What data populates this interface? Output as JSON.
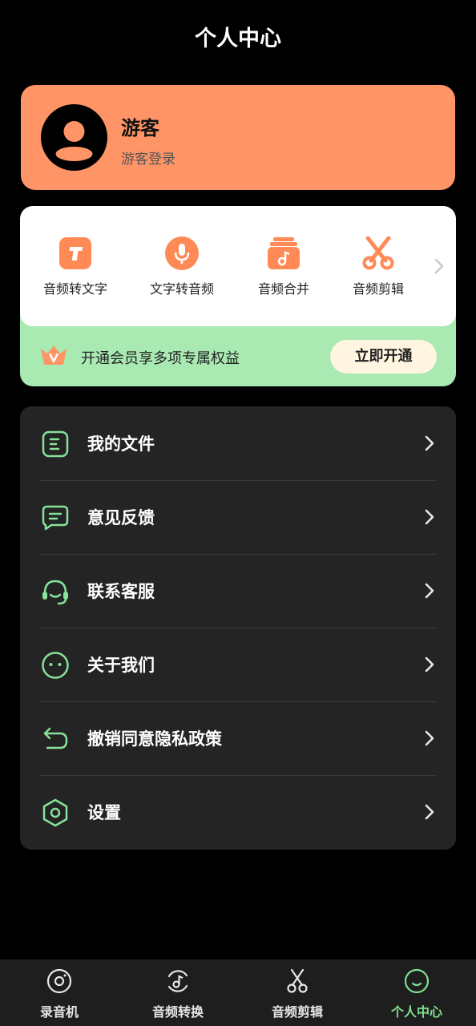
{
  "header": {
    "title": "个人中心"
  },
  "user": {
    "name": "游客",
    "login_label": "游客登录"
  },
  "tools": [
    {
      "label": "音频转文字",
      "icon": "text-t-icon"
    },
    {
      "label": "文字转音频",
      "icon": "microphone-icon"
    },
    {
      "label": "音频合并",
      "icon": "music-merge-icon"
    },
    {
      "label": "音频剪辑",
      "icon": "scissors-icon"
    }
  ],
  "vip": {
    "text": "开通会员享多项专属权益",
    "button_label": "立即开通"
  },
  "menu": [
    {
      "label": "我的文件",
      "icon": "file-icon"
    },
    {
      "label": "意见反馈",
      "icon": "feedback-icon"
    },
    {
      "label": "联系客服",
      "icon": "headset-icon"
    },
    {
      "label": "关于我们",
      "icon": "smiley-icon"
    },
    {
      "label": "撤销同意隐私政策",
      "icon": "undo-icon"
    },
    {
      "label": "设置",
      "icon": "settings-hexagon-icon"
    }
  ],
  "nav": [
    {
      "label": "录音机",
      "icon": "record-disc-icon",
      "active": false
    },
    {
      "label": "音频转换",
      "icon": "music-convert-icon",
      "active": false
    },
    {
      "label": "音频剪辑",
      "icon": "scissors-icon",
      "active": false
    },
    {
      "label": "个人中心",
      "icon": "profile-smile-icon",
      "active": true
    }
  ],
  "colors": {
    "accent_orange": "#ff9466",
    "accent_green": "#7ee08f",
    "vip_band": "#a8eab2",
    "menu_bg": "#242424"
  }
}
